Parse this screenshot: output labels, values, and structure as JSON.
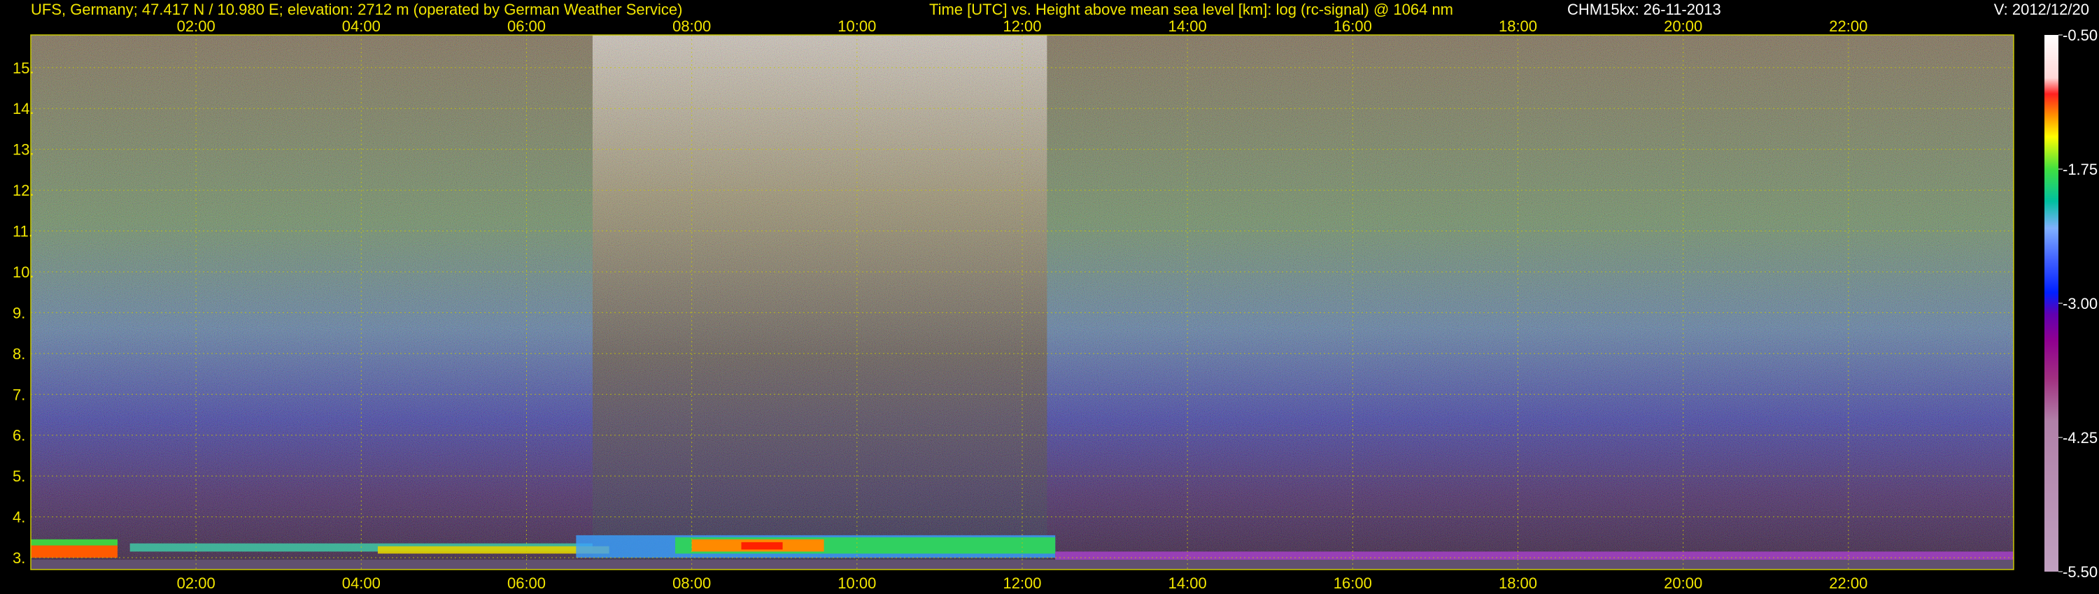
{
  "header": {
    "station": "UFS, Germany; 47.417 N / 10.980 E; elevation: 2712 m  (operated by German Weather Service)",
    "plot_description": "Time [UTC] vs. Height above mean sea level [km]: log (rc-signal) @ 1064 nm",
    "instrument_date": "CHM15kx: 26-11-2013",
    "version": "V: 2012/12/20"
  },
  "colors": {
    "background": "#000000",
    "label_yellow": "#f2e600",
    "grid": "#c8c800",
    "header_white": "#ffffff"
  },
  "chart_data": {
    "type": "heatmap",
    "x_ticks": [
      "02:00",
      "04:00",
      "06:00",
      "08:00",
      "10:00",
      "12:00",
      "14:00",
      "16:00",
      "18:00",
      "20:00",
      "22:00"
    ],
    "x_tick_hours": [
      2,
      4,
      6,
      8,
      10,
      12,
      14,
      16,
      18,
      20,
      22
    ],
    "x_range_hours": [
      0,
      24
    ],
    "y_ticks": [
      "3.",
      "4.",
      "5.",
      "6.",
      "7.",
      "8.",
      "9.",
      "10.",
      "11.",
      "12.",
      "13.",
      "14.",
      "15."
    ],
    "y_tick_values": [
      3,
      4,
      5,
      6,
      7,
      8,
      9,
      10,
      11,
      12,
      13,
      14,
      15
    ],
    "y_range_km": [
      2.71,
      15.8
    ],
    "grid": true,
    "colorbar": {
      "ticks": [
        "-0.50",
        "-1.75",
        "-3.00",
        "-4.25",
        "-5.50"
      ],
      "tick_values": [
        -0.5,
        -1.75,
        -3.0,
        -4.25,
        -5.5
      ],
      "range": [
        -5.5,
        -0.5
      ],
      "stops": [
        [
          -0.5,
          "#ffffff"
        ],
        [
          -0.9,
          "#ffd8d8"
        ],
        [
          -1.05,
          "#ff2020"
        ],
        [
          -1.25,
          "#ff9000"
        ],
        [
          -1.45,
          "#ffff00"
        ],
        [
          -1.75,
          "#40e040"
        ],
        [
          -2.05,
          "#00c0a0"
        ],
        [
          -2.3,
          "#80b0ff"
        ],
        [
          -2.6,
          "#4060ff"
        ],
        [
          -2.9,
          "#0020ff"
        ],
        [
          -3.1,
          "#6000b0"
        ],
        [
          -3.35,
          "#900090"
        ],
        [
          -3.7,
          "#a03080"
        ],
        [
          -4.1,
          "#b080a8"
        ],
        [
          -5.5,
          "#c0a0c0"
        ]
      ]
    },
    "description_features": {
      "noise_white_period_hours": [
        6.8,
        12.3
      ],
      "boundary_layer_top_km": 3.55,
      "cloud_layer_hours": [
        7.8,
        12.4
      ]
    }
  }
}
